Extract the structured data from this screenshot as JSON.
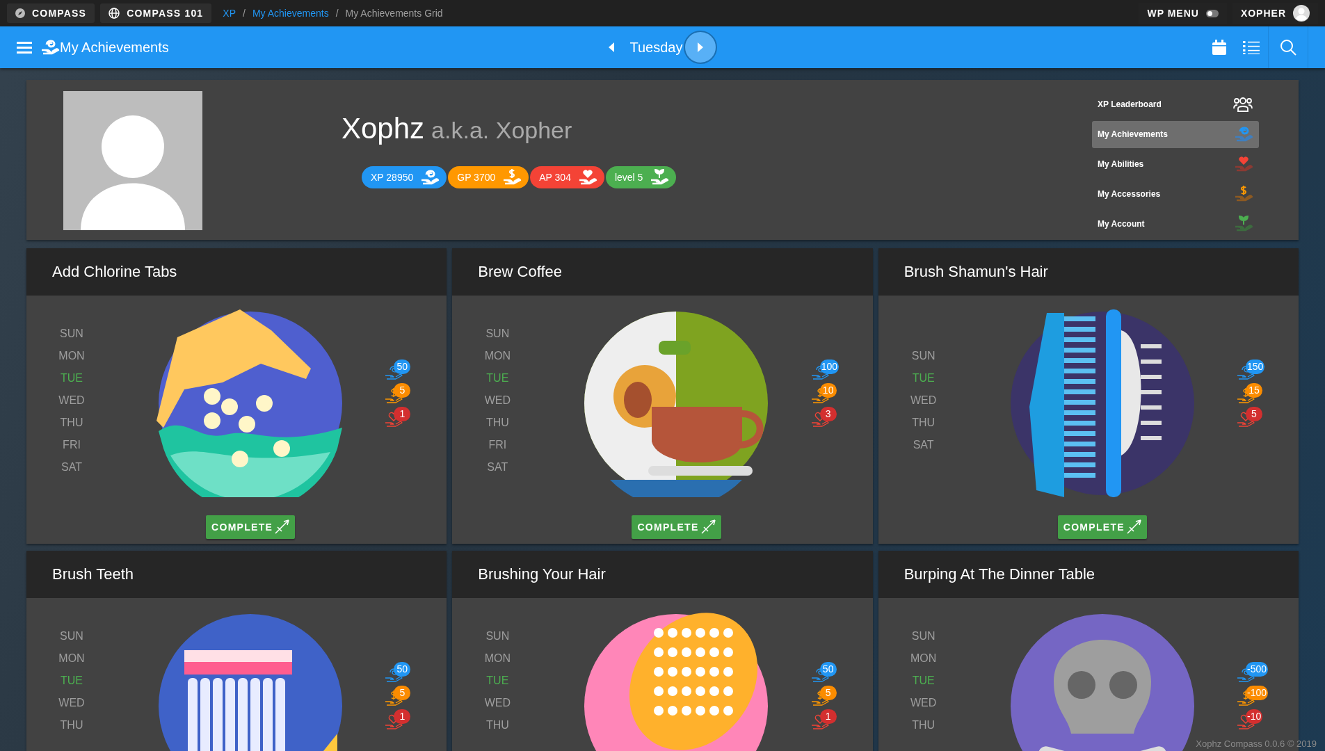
{
  "topbar": {
    "apps": [
      {
        "kind": "compass",
        "label": "COMPASS"
      },
      {
        "kind": "globe",
        "label": "COMPASS 101"
      }
    ],
    "breadcrumbs": [
      {
        "label": "XP",
        "link": true,
        "separator_after": "/"
      },
      {
        "label": "My Achievements",
        "link": true,
        "separator_after": "/"
      },
      {
        "label": "My Achievements Grid",
        "link": false
      }
    ],
    "wp_menu": {
      "label": "WP MENU",
      "on": false
    },
    "user": {
      "label": "XOPHER"
    }
  },
  "header": {
    "title": "My Achievements",
    "day": "Tuesday"
  },
  "profile": {
    "name": "Xophz",
    "alias": "a.k.a. Xopher",
    "stats": [
      {
        "kind": "xp",
        "label": "XP 28950"
      },
      {
        "kind": "gp",
        "label": "GP 3700"
      },
      {
        "kind": "ap",
        "label": "AP 304"
      },
      {
        "kind": "level",
        "label": "level 5"
      }
    ]
  },
  "side_menu": [
    {
      "kind": "leaderboard",
      "label": "XP Leaderboard",
      "selected": false
    },
    {
      "kind": "xp",
      "label": "My Achievements",
      "selected": true
    },
    {
      "kind": "ap",
      "label": "My Abilities",
      "selected": false
    },
    {
      "kind": "gp",
      "label": "My Accessories",
      "selected": false
    },
    {
      "kind": "level",
      "label": "My Account",
      "selected": false
    }
  ],
  "achievements": [
    {
      "title": "Add Chlorine Tabs",
      "kind": "chlorine",
      "days": [
        {
          "label": "SUN",
          "today": false
        },
        {
          "label": "MON",
          "today": false
        },
        {
          "label": "TUE",
          "today": true
        },
        {
          "label": "WED",
          "today": false
        },
        {
          "label": "THU",
          "today": false
        },
        {
          "label": "FRI",
          "today": false
        },
        {
          "label": "SAT",
          "today": false
        }
      ],
      "rewards": [
        {
          "kind": "xp",
          "value": "50"
        },
        {
          "kind": "gp",
          "value": "5"
        },
        {
          "kind": "ap",
          "value": "1"
        }
      ],
      "button": "COMPLETE"
    },
    {
      "title": "Brew Coffee",
      "kind": "coffee",
      "days": [
        {
          "label": "SUN",
          "today": false
        },
        {
          "label": "MON",
          "today": false
        },
        {
          "label": "TUE",
          "today": true
        },
        {
          "label": "WED",
          "today": false
        },
        {
          "label": "THU",
          "today": false
        },
        {
          "label": "FRI",
          "today": false
        },
        {
          "label": "SAT",
          "today": false
        }
      ],
      "rewards": [
        {
          "kind": "xp",
          "value": "100"
        },
        {
          "kind": "gp",
          "value": "10"
        },
        {
          "kind": "ap",
          "value": "3"
        }
      ],
      "button": "COMPLETE"
    },
    {
      "title": "Brush Shamun's Hair",
      "kind": "comb",
      "days": [
        {
          "label": "SUN",
          "today": false
        },
        {
          "label": "TUE",
          "today": true
        },
        {
          "label": "WED",
          "today": false
        },
        {
          "label": "THU",
          "today": false
        },
        {
          "label": "SAT",
          "today": false
        }
      ],
      "rewards": [
        {
          "kind": "xp",
          "value": "150"
        },
        {
          "kind": "gp",
          "value": "15"
        },
        {
          "kind": "ap",
          "value": "5"
        }
      ],
      "button": "COMPLETE"
    },
    {
      "title": "Brush Teeth",
      "kind": "toothbrush",
      "days": [
        {
          "label": "SUN",
          "today": false
        },
        {
          "label": "MON",
          "today": false
        },
        {
          "label": "TUE",
          "today": true
        },
        {
          "label": "WED",
          "today": false
        },
        {
          "label": "THU",
          "today": false
        }
      ],
      "rewards": [
        {
          "kind": "xp",
          "value": "50"
        },
        {
          "kind": "gp",
          "value": "5"
        },
        {
          "kind": "ap",
          "value": "1"
        }
      ]
    },
    {
      "title": "Brushing Your Hair",
      "kind": "hairbrush",
      "days": [
        {
          "label": "SUN",
          "today": false
        },
        {
          "label": "MON",
          "today": false
        },
        {
          "label": "TUE",
          "today": true
        },
        {
          "label": "WED",
          "today": false
        },
        {
          "label": "THU",
          "today": false
        }
      ],
      "rewards": [
        {
          "kind": "xp",
          "value": "50"
        },
        {
          "kind": "gp",
          "value": "5"
        },
        {
          "kind": "ap",
          "value": "1"
        }
      ]
    },
    {
      "title": "Burping At The Dinner Table",
      "kind": "skull",
      "days": [
        {
          "label": "SUN",
          "today": false
        },
        {
          "label": "MON",
          "today": false
        },
        {
          "label": "TUE",
          "today": true
        },
        {
          "label": "WED",
          "today": false
        },
        {
          "label": "THU",
          "today": false
        }
      ],
      "rewards": [
        {
          "kind": "xp",
          "value": "-500"
        },
        {
          "kind": "gp",
          "value": "-100"
        },
        {
          "kind": "ap",
          "value": "-10"
        }
      ]
    }
  ],
  "footer": "Xophz Compass 0.0.6 © 2019"
}
